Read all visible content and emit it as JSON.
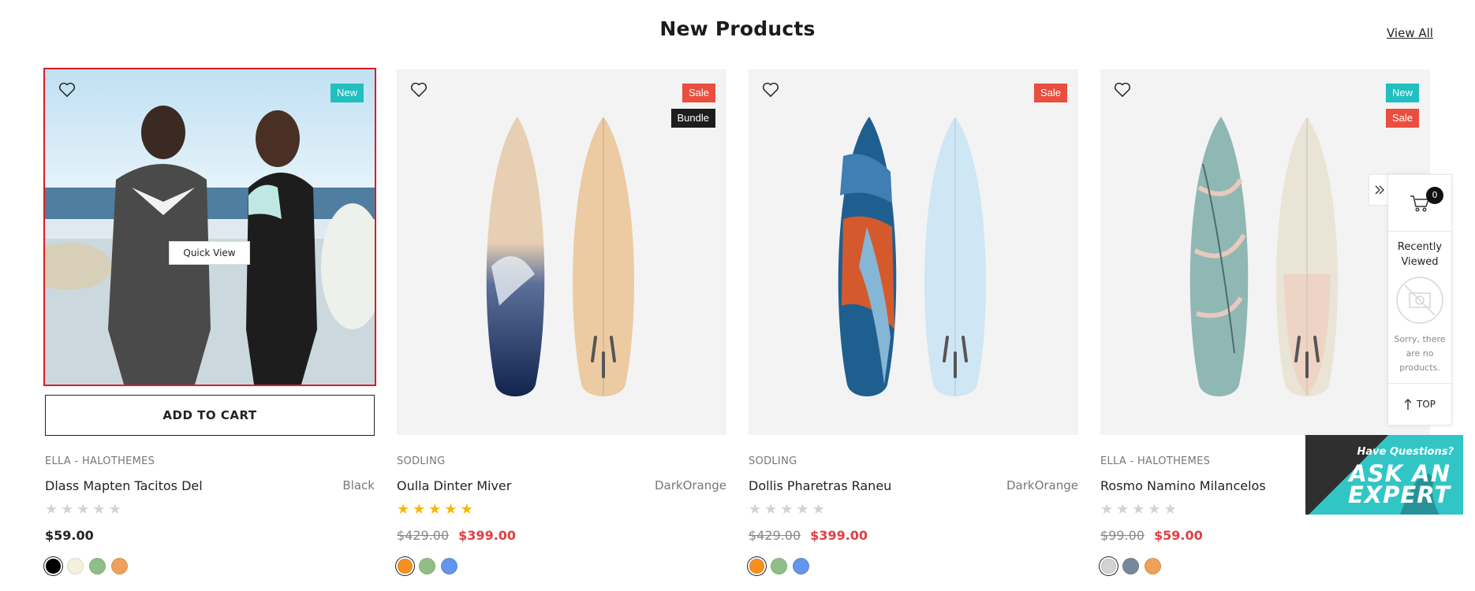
{
  "section": {
    "title": "New Products",
    "view_all": "View All"
  },
  "products": [
    {
      "vendor": "ELLA - HALOTHEMES",
      "name": "Dlass Mapten Tacitos Del",
      "color_label": "Black",
      "badges": [
        "New"
      ],
      "rating": 0,
      "price": "$59.00",
      "quick_view": "Quick View",
      "add_to_cart": "ADD TO CART",
      "swatches": [
        "#000000",
        "#f3f0dc",
        "#8fbf86",
        "#f0a05a"
      ]
    },
    {
      "vendor": "SODLING",
      "name": "Oulla Dinter Miver",
      "color_label": "DarkOrange",
      "badges": [
        "Sale",
        "Bundle"
      ],
      "rating": 5,
      "price_old": "$429.00",
      "price_sale": "$399.00",
      "swatches": [
        "#f7901e",
        "#8fbf86",
        "#6495ed"
      ]
    },
    {
      "vendor": "SODLING",
      "name": "Dollis Pharetras Raneu",
      "color_label": "DarkOrange",
      "badges": [
        "Sale"
      ],
      "rating": 0,
      "price_old": "$429.00",
      "price_sale": "$399.00",
      "swatches": [
        "#f7901e",
        "#8fbf86",
        "#6495ed"
      ]
    },
    {
      "vendor": "ELLA - HALOTHEMES",
      "name": "Rosmo Namino Milancelos",
      "color_label": "",
      "badges": [
        "New",
        "Sale"
      ],
      "rating": 0,
      "price_old": "$99.00",
      "price_sale": "$59.00",
      "swatches": [
        "#d3d3d3",
        "#778899",
        "#f0a05a"
      ]
    }
  ],
  "sidebar": {
    "cart_count": "0",
    "recently_viewed_line1": "Recently",
    "recently_viewed_line2": "Viewed",
    "empty_line1": "Sorry, there",
    "empty_line2": "are no",
    "empty_line3": "products.",
    "top_label": "TOP"
  },
  "expert_banner": {
    "question": "Have Questions?",
    "line1": "ASK AN",
    "line2": "EXPERT"
  }
}
